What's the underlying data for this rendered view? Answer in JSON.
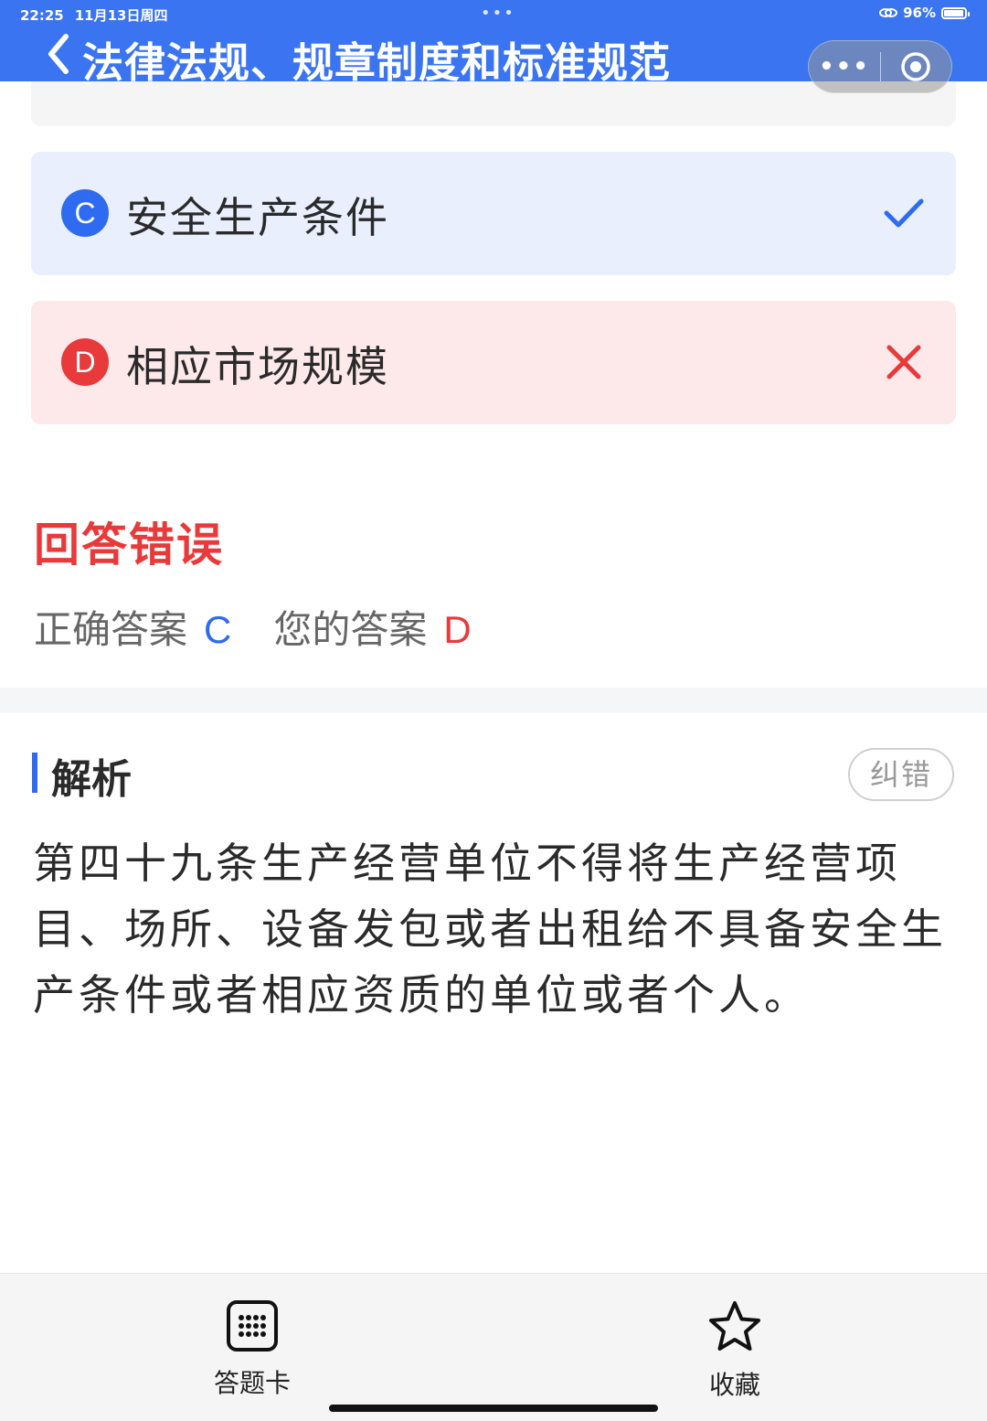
{
  "status_bar": {
    "time": "22:25",
    "date": "11月13日周四",
    "dots": "•••",
    "battery": "96%",
    "battery_level": 0.96
  },
  "nav": {
    "title": "法律法规、规章制度和标准规范",
    "capsule_more": "•••"
  },
  "options": [
    {
      "letter": "C",
      "text": "安全生产条件",
      "state": "correct"
    },
    {
      "letter": "D",
      "text": "相应市场规模",
      "state": "wrong"
    }
  ],
  "result": {
    "status": "回答错误",
    "correct_label": "正确答案",
    "correct_value": "C",
    "yours_label": "您的答案",
    "yours_value": "D"
  },
  "analysis": {
    "title": "解析",
    "report_button": "纠错",
    "text": "第四十九条生产经营单位不得将生产经营项目、场所、设备发包或者出租给不具备安全生产条件或者相应资质的单位或者个人。"
  },
  "tabbar": {
    "card_label": "答题卡",
    "favorite_label": "收藏"
  },
  "colors": {
    "primary": "#3a74f1",
    "correct": "#2f6bf0",
    "wrong": "#e8393b",
    "correct_bg": "#e9effd",
    "wrong_bg": "#fde9e9"
  }
}
